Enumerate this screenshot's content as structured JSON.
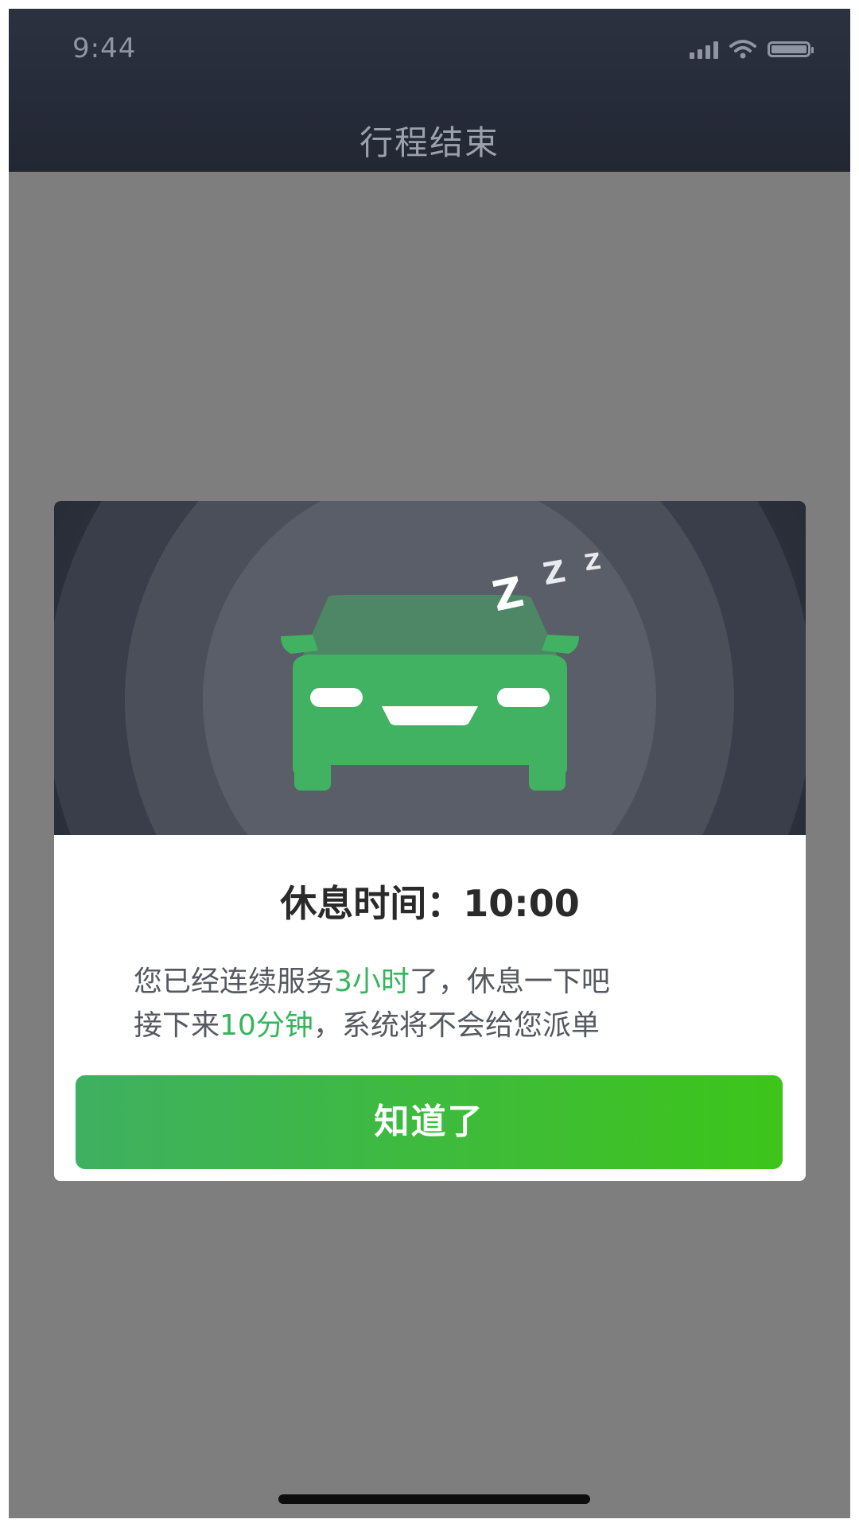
{
  "status_bar": {
    "time": "9:44",
    "icons": [
      "signal-icon",
      "wifi-icon",
      "battery-icon"
    ]
  },
  "nav": {
    "title": "行程结束"
  },
  "modal": {
    "illustration": "sleeping-car-icon",
    "zzz": [
      "Z",
      "Z",
      "Z"
    ],
    "title": "休息时间：10:00",
    "line1": {
      "pre": "您已经连续服务",
      "highlight": "3小时",
      "post": "了，休息一下吧"
    },
    "line2": {
      "pre": "接下来",
      "highlight": "10分钟",
      "post": "，系统将不会给您派单"
    },
    "button_label": "知道了"
  },
  "colors": {
    "accent": "#36b55d",
    "button_start": "#3fb061",
    "button_end": "#3dc51a",
    "header_bg": "#262b37",
    "overlay": "#7e7e7e"
  }
}
